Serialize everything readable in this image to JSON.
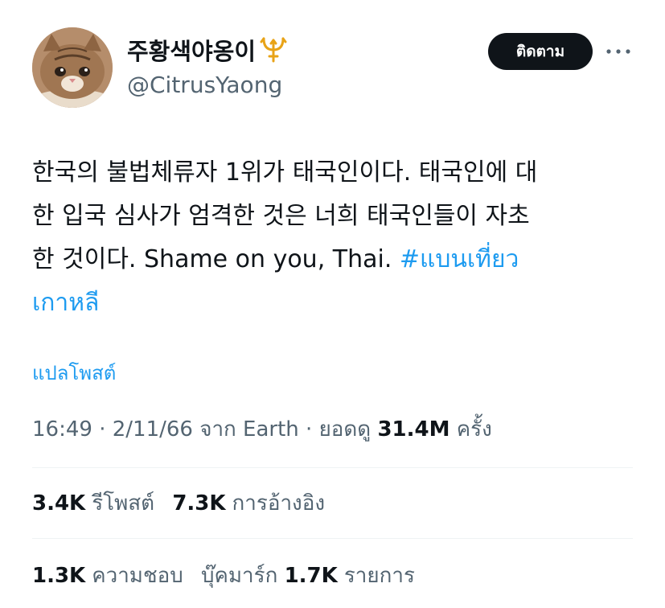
{
  "author": {
    "display_name": "주황색야옹이",
    "handle": "@CitrusYaong",
    "avatar_icon": "cat-avatar",
    "name_emoji_icon": "trident-icon"
  },
  "header": {
    "follow_label": "ติดตาม",
    "more_icon": "more-horizontal-icon"
  },
  "tweet": {
    "lines": [
      "한국의 불법체류자 1위가 태국인이다. 태국인에 대",
      "한 입국 심사가 엄격한 것은 너희 태국인들이 자초",
      "한 것이다. Shame on you, Thai. "
    ],
    "hashtag_part1": "#แบนเที่ยว",
    "hashtag_part2": "เกาหลี",
    "translate_label": "แปลโพสต์"
  },
  "meta": {
    "time_date_source": "16:49 · 2/11/66 จาก Earth · ยอดดู ",
    "views_count": "31.4M",
    "views_suffix": " ครั้ง"
  },
  "stats": {
    "reposts_count": "3.4K",
    "reposts_label": "รีโพสต์",
    "quotes_count": "7.3K",
    "quotes_label": "การอ้างอิง",
    "likes_count": "1.3K",
    "likes_label": "ความชอบ",
    "bookmarks_label": "บุ๊คมาร์ก",
    "bookmarks_count": "1.7K",
    "bookmarks_suffix": "รายการ"
  },
  "colors": {
    "text_primary": "#0f1419",
    "text_secondary": "#536471",
    "link_blue": "#1d9bf0",
    "divider": "#eff3f4",
    "trident_gold": "#e8a317"
  }
}
